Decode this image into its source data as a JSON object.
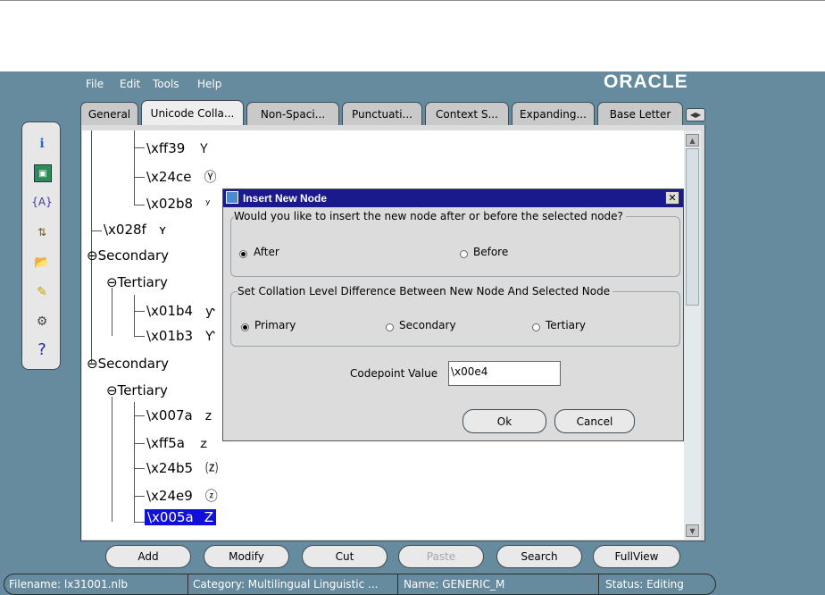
{
  "menu": {
    "file": "File",
    "edit": "Edit",
    "tools": "Tools",
    "help": "Help"
  },
  "brand": "ORACLE",
  "tabs": [
    {
      "label": "General"
    },
    {
      "label": "Unicode Colla..."
    },
    {
      "label": "Non-Spaci..."
    },
    {
      "label": "Punctuati..."
    },
    {
      "label": "Context S..."
    },
    {
      "label": "Expanding..."
    },
    {
      "label": "Base Letter"
    }
  ],
  "toolbar_icons": [
    "info-icon",
    "image-icon",
    "variable-icon",
    "sort-icon",
    "open-folder-icon",
    "edit-note-icon",
    "settings-icon",
    "help-icon"
  ],
  "tree": {
    "n1": {
      "code": "\\xff39",
      "char": "Ｙ"
    },
    "n2": {
      "code": "\\x24ce",
      "char": "Ⓨ"
    },
    "n3": {
      "code": "\\x02b8",
      "char": "ʸ"
    },
    "n4": {
      "code": "\\x028f",
      "char": "ʏ"
    },
    "sec1": "Secondary",
    "ter1": "Tertiary",
    "n5": {
      "code": "\\x01b4",
      "char": "ƴ"
    },
    "n6": {
      "code": "\\x01b3",
      "char": "Ƴ"
    },
    "sec2": "Secondary",
    "ter2": "Tertiary",
    "n7": {
      "code": "\\x007a",
      "char": "z"
    },
    "n8": {
      "code": "\\xff5a",
      "char": "ｚ"
    },
    "n9": {
      "code": "\\x24b5",
      "char": "⒵"
    },
    "n10": {
      "code": "\\x24e9",
      "char": "ⓩ"
    },
    "n11": {
      "code": "\\x005a",
      "char": "Z"
    }
  },
  "buttons": {
    "add": "Add",
    "modify": "Modify",
    "cut": "Cut",
    "paste": "Paste",
    "search": "Search",
    "fullview": "FullView"
  },
  "status": {
    "filename": "Filename: lx31001.nlb",
    "category": "Category: Multilingual Linguistic ...",
    "name": "Name: GENERIC_M",
    "state": "Status: Editing"
  },
  "dialog": {
    "title": "Insert New Node",
    "q1": "Would you like to insert the new node after or before the selected node?",
    "after": "After",
    "before": "Before",
    "q2": "Set Collation Level Difference Between New Node And Selected Node",
    "primary": "Primary",
    "secondary": "Secondary",
    "tertiary": "Tertiary",
    "codepoint_label": "Codepoint Value",
    "codepoint_value": "\\x00e4",
    "ok": "Ok",
    "cancel": "Cancel"
  },
  "colors": {
    "app_bg": "#668a9e",
    "title_bar": "#1a1a8c",
    "selection": "#1010d8"
  }
}
